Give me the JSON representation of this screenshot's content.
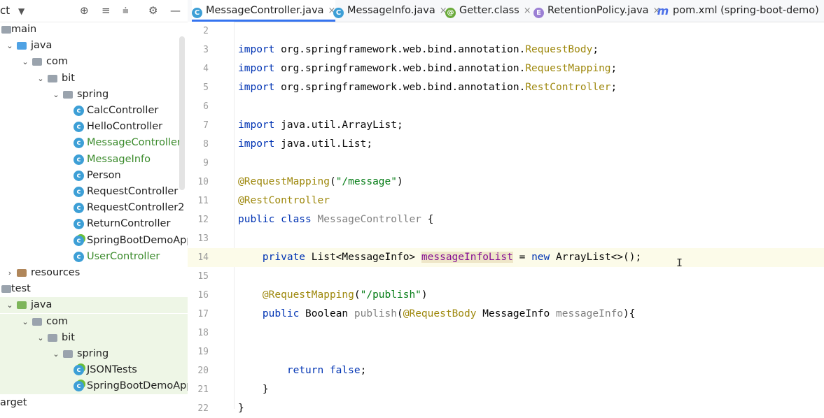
{
  "sidebar": {
    "title": "ct",
    "tree": [
      {
        "label": "main",
        "icon": "folder",
        "indent": 0,
        "arrow": "",
        "green": false
      },
      {
        "label": "java",
        "icon": "folder-blue",
        "indent": 1,
        "arrow": "v",
        "green": false
      },
      {
        "label": "com",
        "icon": "package",
        "indent": 2,
        "arrow": "v",
        "green": false
      },
      {
        "label": "bit",
        "icon": "package",
        "indent": 3,
        "arrow": "v",
        "green": false
      },
      {
        "label": "spring",
        "icon": "package",
        "indent": 4,
        "arrow": "v",
        "green": false
      },
      {
        "label": "CalcController",
        "icon": "class",
        "indent": 5,
        "green": false
      },
      {
        "label": "HelloController",
        "icon": "class",
        "indent": 5,
        "green": false
      },
      {
        "label": "MessageController",
        "icon": "class",
        "indent": 5,
        "green": false,
        "text_green": true
      },
      {
        "label": "MessageInfo",
        "icon": "class",
        "indent": 5,
        "green": false,
        "text_green": true
      },
      {
        "label": "Person",
        "icon": "class",
        "indent": 5,
        "green": false
      },
      {
        "label": "RequestController",
        "icon": "class",
        "indent": 5,
        "green": false
      },
      {
        "label": "RequestController2",
        "icon": "class",
        "indent": 5,
        "green": false
      },
      {
        "label": "ReturnController",
        "icon": "class",
        "indent": 5,
        "green": false
      },
      {
        "label": "SpringBootDemoAppl",
        "icon": "spring-class",
        "indent": 5,
        "green": false
      },
      {
        "label": "UserController",
        "icon": "class",
        "indent": 5,
        "green": false,
        "text_green": true
      },
      {
        "label": "resources",
        "icon": "folder-res",
        "indent": 1,
        "arrow": ">",
        "green": false
      },
      {
        "label": "test",
        "icon": "folder",
        "indent": 0,
        "arrow": "",
        "green": false
      },
      {
        "label": "java",
        "icon": "folder-green",
        "indent": 1,
        "arrow": "v",
        "green": true
      },
      {
        "label": "com",
        "icon": "package",
        "indent": 2,
        "arrow": "v",
        "green": true
      },
      {
        "label": "bit",
        "icon": "package",
        "indent": 3,
        "arrow": "v",
        "green": true
      },
      {
        "label": "spring",
        "icon": "package",
        "indent": 4,
        "arrow": "v",
        "green": true
      },
      {
        "label": "JSONTests",
        "icon": "spring-class",
        "indent": 5,
        "green": true
      },
      {
        "label": "SpringBootDemoAppl",
        "icon": "spring-class",
        "indent": 5,
        "green": true
      },
      {
        "label": "arget",
        "icon": "none",
        "indent": 0,
        "green": false
      }
    ]
  },
  "tabs": [
    {
      "label": "MessageController.java",
      "icon": "C",
      "active": true,
      "closable": true
    },
    {
      "label": "MessageInfo.java",
      "icon": "C",
      "active": false,
      "closable": true
    },
    {
      "label": "Getter.class",
      "icon": "@",
      "active": false,
      "closable": true
    },
    {
      "label": "RetentionPolicy.java",
      "icon": "E",
      "active": false,
      "closable": true
    },
    {
      "label": "pom.xml (spring-boot-demo)",
      "icon": "m",
      "active": false,
      "closable": true
    }
  ],
  "code": [
    {
      "n": "2",
      "html": ""
    },
    {
      "n": "3",
      "html": "<span class=\"kw\">import</span> org.springframework.web.bind.annotation.<span class=\"ann\">RequestBody</span>;"
    },
    {
      "n": "4",
      "html": "<span class=\"kw\">import</span> org.springframework.web.bind.annotation.<span class=\"ann\">RequestMapping</span>;"
    },
    {
      "n": "5",
      "html": "<span class=\"kw\">import</span> org.springframework.web.bind.annotation.<span class=\"ann\">RestController</span>;"
    },
    {
      "n": "6",
      "html": ""
    },
    {
      "n": "7",
      "html": "<span class=\"kw\">import</span> java.util.ArrayList;"
    },
    {
      "n": "8",
      "html": "<span class=\"kw\">import</span> java.util.List;"
    },
    {
      "n": "9",
      "html": ""
    },
    {
      "n": "10",
      "html": "<span class=\"ann\">@RequestMapping</span>(<span class=\"str\">\"/message\"</span>)"
    },
    {
      "n": "11",
      "html": "<span class=\"ann\">@RestController</span>"
    },
    {
      "n": "12",
      "html": "<span class=\"kw\">public class</span> <span class=\"grey\">MessageController</span> {"
    },
    {
      "n": "13",
      "html": ""
    },
    {
      "n": "14",
      "html": "    <span class=\"kw\">private</span> List&lt;MessageInfo&gt; <span class=\"hl\">messageInfoList</span> = <span class=\"kw\">new</span> ArrayList&lt;&gt;();",
      "current": true
    },
    {
      "n": "15",
      "html": ""
    },
    {
      "n": "16",
      "html": "    <span class=\"ann\">@RequestMapping</span>(<span class=\"str\">\"/publish\"</span>)"
    },
    {
      "n": "17",
      "html": "    <span class=\"kw\">public</span> Boolean <span class=\"grey\">publish</span>(<span class=\"ann\">@RequestBody</span> MessageInfo <span class=\"param\">messageInfo</span>){"
    },
    {
      "n": "18",
      "html": ""
    },
    {
      "n": "19",
      "html": ""
    },
    {
      "n": "20",
      "html": "        <span class=\"kw\">return false</span>;"
    },
    {
      "n": "21",
      "html": "    }"
    },
    {
      "n": "22",
      "html": "}"
    }
  ]
}
